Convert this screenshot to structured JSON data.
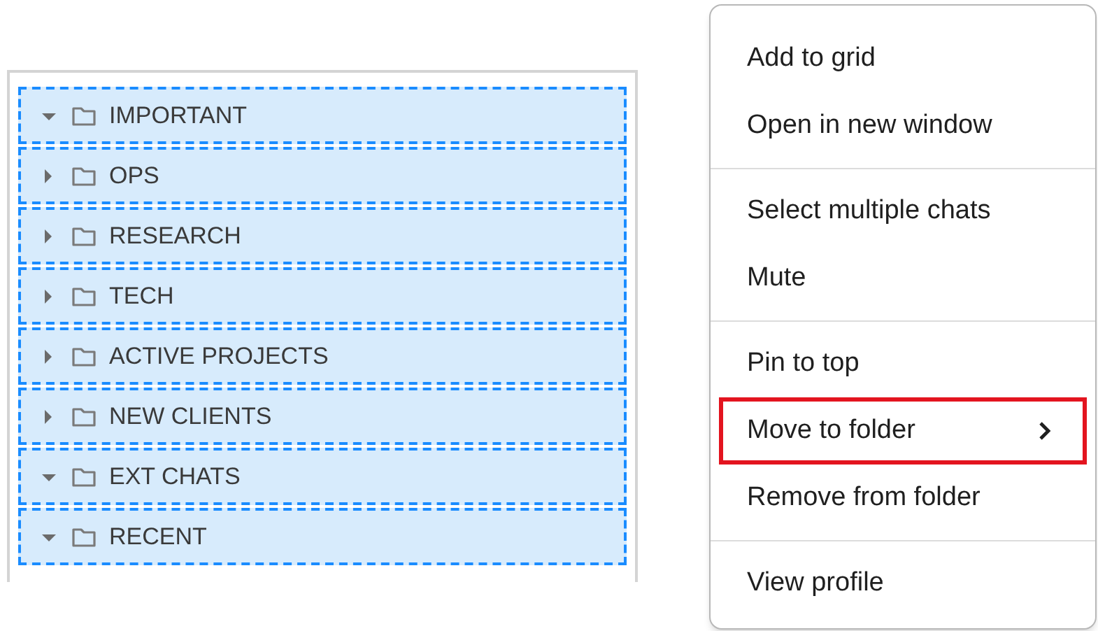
{
  "folders": [
    {
      "label": "IMPORTANT",
      "expanded": true
    },
    {
      "label": "OPS",
      "expanded": false
    },
    {
      "label": "RESEARCH",
      "expanded": false
    },
    {
      "label": "TECH",
      "expanded": false
    },
    {
      "label": "ACTIVE PROJECTS",
      "expanded": false
    },
    {
      "label": "NEW CLIENTS",
      "expanded": false
    },
    {
      "label": "EXT CHATS",
      "expanded": true
    },
    {
      "label": "RECENT",
      "expanded": true
    }
  ],
  "context_menu": {
    "groups": [
      [
        {
          "label": "Add to grid",
          "highlighted": false,
          "submenu": false
        },
        {
          "label": "Open in new window",
          "highlighted": false,
          "submenu": false
        }
      ],
      [
        {
          "label": "Select multiple chats",
          "highlighted": false,
          "submenu": false
        },
        {
          "label": "Mute",
          "highlighted": false,
          "submenu": false
        }
      ],
      [
        {
          "label": "Pin to top",
          "highlighted": false,
          "submenu": false
        },
        {
          "label": "Move to folder",
          "highlighted": true,
          "submenu": true
        },
        {
          "label": "Remove from folder",
          "highlighted": false,
          "submenu": false
        }
      ],
      [
        {
          "label": "View profile",
          "highlighted": false,
          "submenu": false
        }
      ]
    ]
  }
}
